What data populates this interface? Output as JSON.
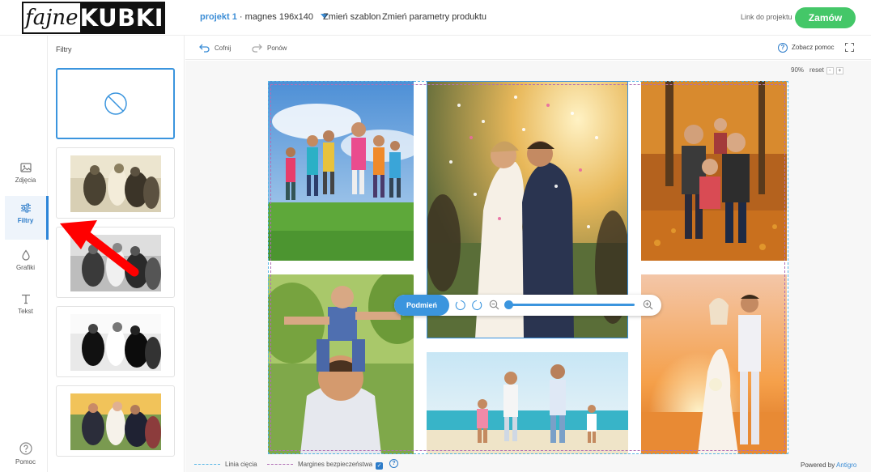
{
  "logo": {
    "part1": "fajne",
    "part2": "KUBKI"
  },
  "header": {
    "project_name": "projekt 1",
    "separator": " · ",
    "product": "magnes 196x140",
    "change_template": "Zmień szablon",
    "change_params": "Zmień parametry produktu",
    "project_link": "Link do projektu",
    "order_button": "Zamów"
  },
  "rail": {
    "items": [
      {
        "label": "Zdjęcia",
        "icon": "image-icon"
      },
      {
        "label": "Filtry",
        "icon": "sliders-icon",
        "active": true
      },
      {
        "label": "Grafiki",
        "icon": "drop-icon"
      },
      {
        "label": "Tekst",
        "icon": "text-icon"
      }
    ],
    "help": "Pomoc"
  },
  "panel": {
    "title": "Filtry",
    "filters": [
      "none",
      "sepia",
      "grayscale",
      "high-contrast-grayscale",
      "color"
    ]
  },
  "toolbar": {
    "undo": "Cofnij",
    "redo": "Ponów",
    "help": "Zobacz pomoc",
    "zoom": "90%",
    "reset": "reset",
    "zoom_minus": "-",
    "zoom_plus": "+"
  },
  "photo_control": {
    "replace": "Podmień"
  },
  "legend": {
    "cut_line": "Linia cięcia",
    "safe_margin": "Margines bezpieczeństwa",
    "safe_checked": true,
    "check": "✓",
    "help": "?"
  },
  "footer": {
    "powered_by": "Powered by",
    "brand": "Antigro"
  },
  "colors": {
    "accent": "#3b95de",
    "order_green": "#44c768",
    "cut_line": "#56b6e6",
    "safe_line": "#b06fb5",
    "annotation_arrow": "#ff0000"
  }
}
